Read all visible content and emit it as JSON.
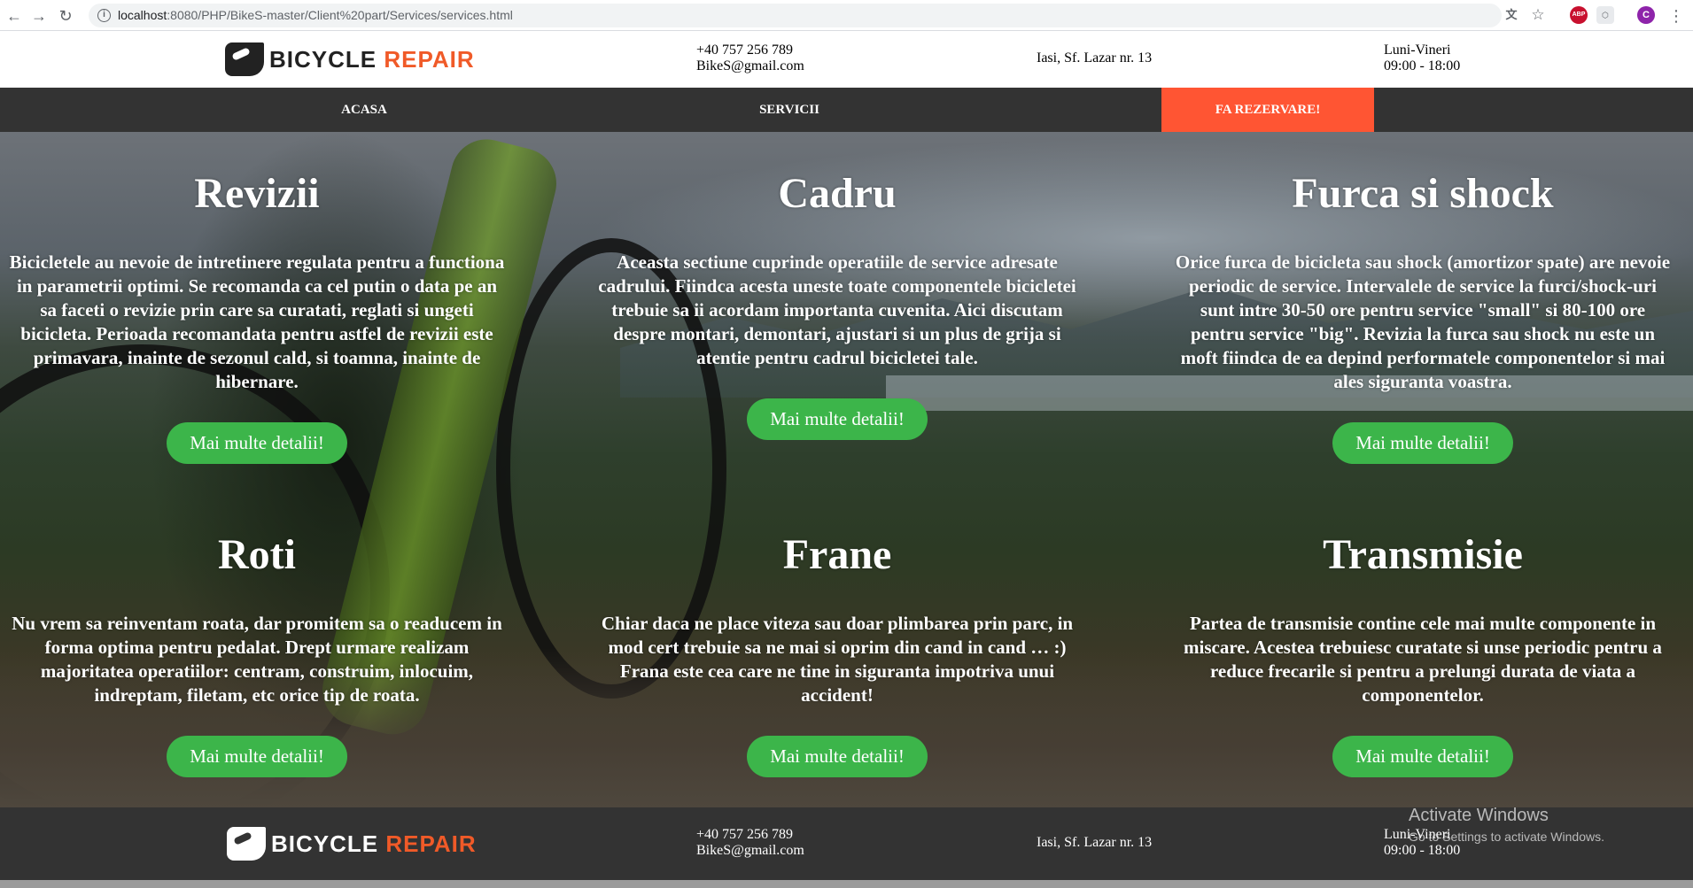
{
  "browser": {
    "url_host": "localhost",
    "url_path": ":8080/PHP/BikeS-master/Client%20part/Services/services.html",
    "ext_abp": "ABP",
    "profile_initial": "C"
  },
  "header": {
    "logo_word1": "BICYCLE",
    "logo_word2": "REPAIR",
    "phone": "+40 757 256 789",
    "email": "BikeS@gmail.com",
    "address": "Iasi, Sf. Lazar nr. 13",
    "days": "Luni-Vineri",
    "hours": "09:00 - 18:00"
  },
  "nav": {
    "home": "ACASA",
    "services": "SERVICII",
    "booking": "FA REZERVARE!"
  },
  "services": [
    {
      "title": "Revizii",
      "text": "Bicicletele au nevoie de intretinere regulata pentru a functiona in parametrii optimi. Se recomanda ca cel putin o data pe an sa faceti o revizie prin care sa curatati, reglati si ungeti bicicleta. Perioada recomandata pentru astfel de revizii este primavara, inainte de sezonul cald, si toamna, inainte de hibernare.",
      "button": "Mai multe detalii!"
    },
    {
      "title": "Cadru",
      "text": "Aceasta sectiune cuprinde operatiile de service adresate cadrului. Fiindca acesta uneste toate componentele bicicletei trebuie sa ii acordam importanta cuvenita. Aici discutam despre montari, demontari, ajustari si un plus de grija si atentie pentru cadrul bicicletei tale.",
      "button": "Mai multe detalii!"
    },
    {
      "title": "Furca si shock",
      "text": "Orice furca de bicicleta sau shock (amortizor spate) are nevoie periodic de service. Intervalele de service la furci/shock-uri sunt intre 30-50 ore pentru service \"small\" si 80-100 ore pentru service \"big\". Revizia la furca sau shock nu este un moft fiindca de ea depind performatele componentelor si mai ales siguranta voastra.",
      "button": "Mai multe detalii!"
    },
    {
      "title": "Roti",
      "text": "Nu vrem sa reinventam roata, dar promitem sa o readucem in forma optima pentru pedalat. Drept urmare realizam majoritatea operatiilor: centram, construim, inlocuim, indreptam, filetam, etc orice tip de roata.",
      "button": "Mai multe detalii!"
    },
    {
      "title": "Frane",
      "text": "Chiar daca ne place viteza sau doar plimbarea prin parc, in mod cert trebuie sa ne mai si oprim din cand in cand … :) Frana este cea care ne tine in siguranta impotriva unui accident!",
      "button": "Mai multe detalii!"
    },
    {
      "title": "Transmisie",
      "text": "Partea de transmisie contine cele mai multe componente in miscare. Acestea trebuiesc curatate si unse periodic pentru a reduce frecarile si pentru a prelungi durata de viata a componentelor.",
      "button": "Mai multe detalii!"
    }
  ],
  "footer": {
    "logo_word1": "BICYCLE",
    "logo_word2": "REPAIR",
    "phone": "+40 757 256 789",
    "email": "BikeS@gmail.com",
    "address": "Iasi, Sf. Lazar nr. 13",
    "days": "Luni-Vineri",
    "hours": "09:00 - 18:00"
  },
  "watermark": {
    "line1": "Activate Windows",
    "line2": "Go to Settings to activate Windows."
  },
  "colors": {
    "accent_orange": "#ff5533",
    "button_green": "#3cb54a",
    "nav_dark": "#333333"
  },
  "icons": [
    "back-arrow-icon",
    "forward-arrow-icon",
    "reload-icon",
    "info-icon",
    "translate-icon",
    "star-icon",
    "bike-logo-icon"
  ]
}
